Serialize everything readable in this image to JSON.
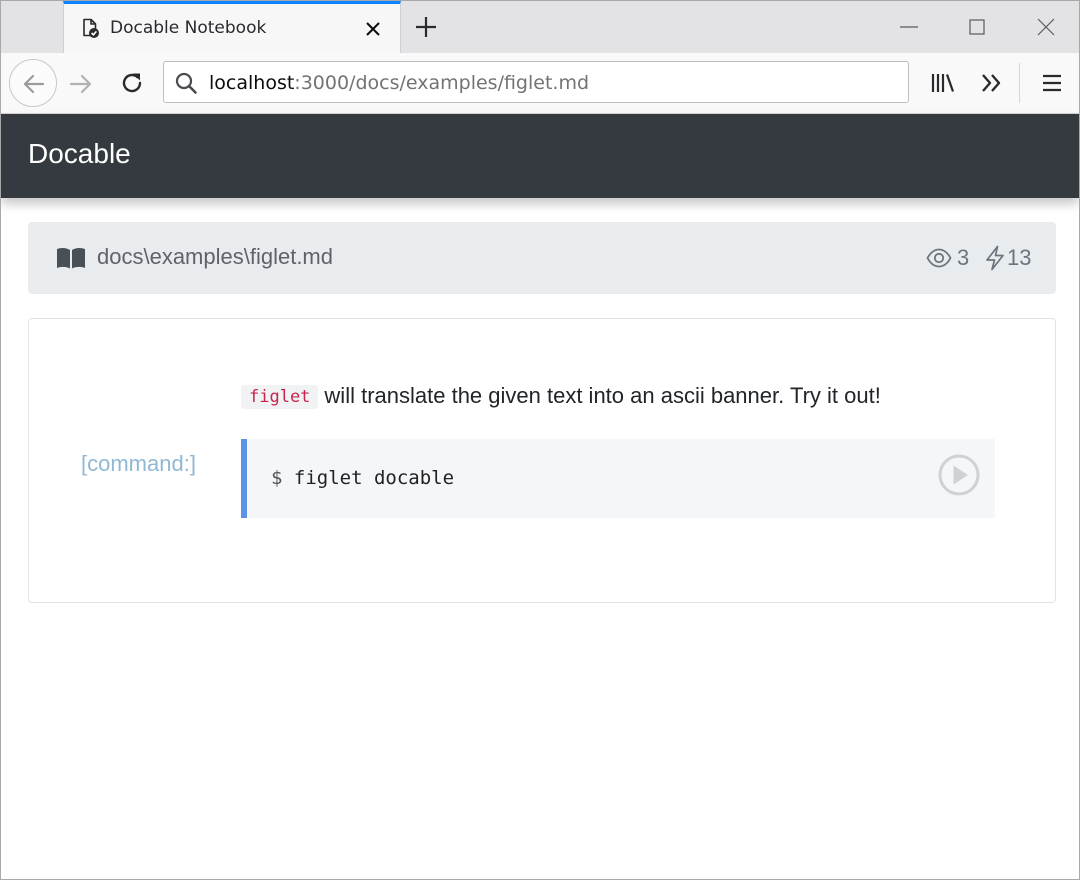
{
  "browser": {
    "tab_title": "Docable Notebook",
    "url_host": "localhost",
    "url_rest": ":3000/docs/examples/figlet.md"
  },
  "app": {
    "brand": "Docable"
  },
  "breadcrumb": {
    "path": "docs\\examples\\figlet.md",
    "views": "3",
    "runs": "13"
  },
  "content": {
    "inline_code": "figlet",
    "paragraph_rest": "will translate the given text into an ascii banner. Try it out!",
    "cell_label": "[command:]",
    "command_prompt": "$",
    "command": "figlet docable"
  },
  "colors": {
    "header_bg": "#343a40",
    "tab_accent": "#0a84ff",
    "code_accent": "#5b93e6",
    "cell_label": "#8fb8d4",
    "inline_code": "#c7254e"
  },
  "icons": {
    "tab": "page-check-icon",
    "breadcrumb": "open-book-icon",
    "views": "eye-icon",
    "runs": "lightning-icon",
    "run": "play-circle-icon"
  }
}
